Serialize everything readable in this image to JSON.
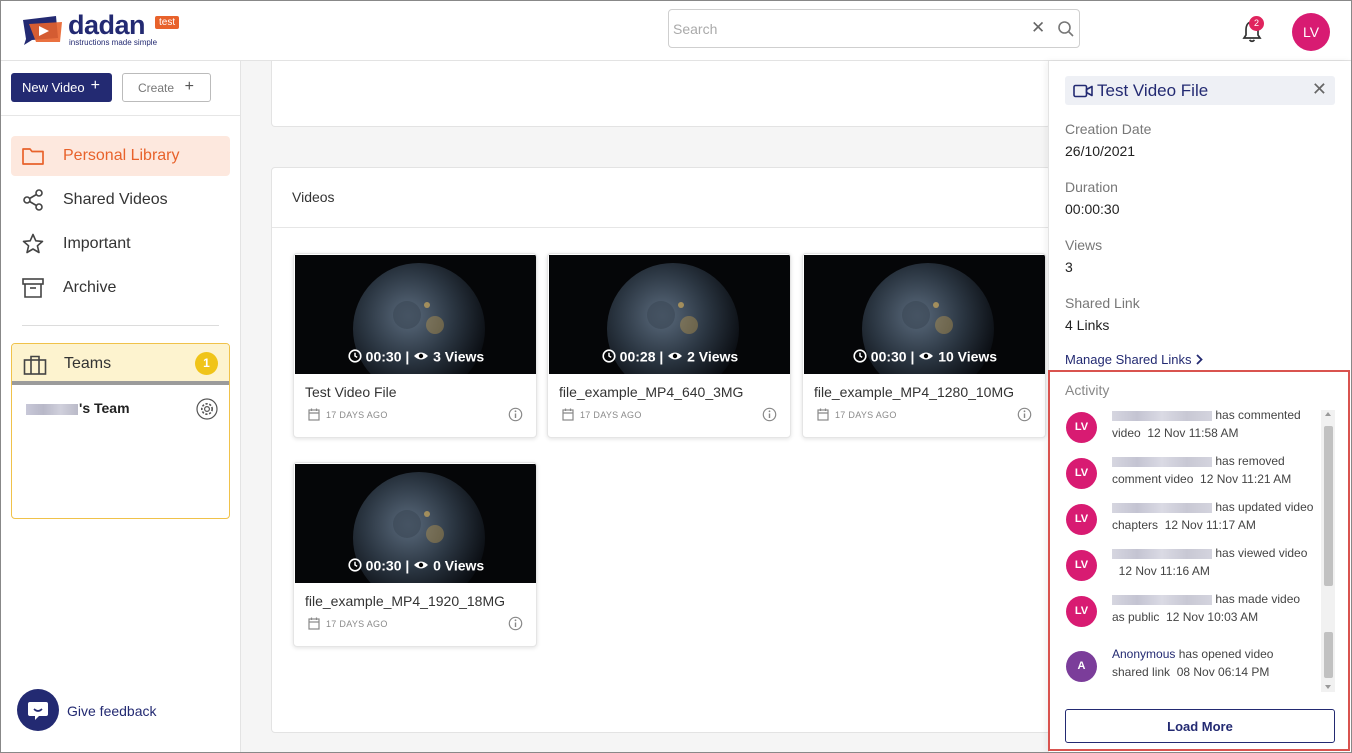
{
  "brand": {
    "name": "dadan",
    "tag": "test",
    "tagline": "instructions made simple"
  },
  "search": {
    "placeholder": "Search",
    "value": ""
  },
  "notifications": {
    "count": "2"
  },
  "user": {
    "initials": "LV"
  },
  "toolbar": {
    "new_video_label": "New Video",
    "create_label": "Create"
  },
  "sidebar": {
    "items": [
      {
        "label": "Personal Library",
        "icon": "folder-icon",
        "active": true
      },
      {
        "label": "Shared Videos",
        "icon": "share-icon"
      },
      {
        "label": "Important",
        "icon": "star-icon"
      },
      {
        "label": "Archive",
        "icon": "archive-icon"
      }
    ],
    "teams": {
      "label": "Teams",
      "count": "1",
      "team_suffix": "'s Team"
    },
    "feedback_label": "Give feedback"
  },
  "main": {
    "section_title": "Videos",
    "videos": [
      {
        "title": "Test Video File",
        "duration": "00:30",
        "views": "3 Views",
        "age": "17 DAYS AGO"
      },
      {
        "title": "file_example_MP4_640_3MG",
        "duration": "00:28",
        "views": "2 Views",
        "age": "17 DAYS AGO"
      },
      {
        "title": "file_example_MP4_1280_10MG",
        "duration": "00:30",
        "views": "10 Views",
        "age": "17 DAYS AGO"
      },
      {
        "title": "file_example_MP4_1920_18MG",
        "duration": "00:30",
        "views": "0 Views",
        "age": "17 DAYS AGO"
      }
    ]
  },
  "detail": {
    "title": "Test Video File",
    "creation_date_label": "Creation Date",
    "creation_date": "26/10/2021",
    "duration_label": "Duration",
    "duration": "00:00:30",
    "views_label": "Views",
    "views": "3",
    "shared_link_label": "Shared Link",
    "shared_link": "4 Links",
    "manage_links_label": "Manage Shared Links",
    "activity_label": "Activity",
    "activity": [
      {
        "avatar": "LV",
        "action": "has commented",
        "rest": "video",
        "time": "12 Nov 11:58 AM"
      },
      {
        "avatar": "LV",
        "action": "has removed",
        "rest": "comment video",
        "time": "12 Nov 11:21 AM"
      },
      {
        "avatar": "LV",
        "action": "has updated video",
        "rest": "chapters",
        "time": "12 Nov 11:17 AM"
      },
      {
        "avatar": "LV",
        "action": "has viewed video",
        "rest": "",
        "time": "12 Nov 11:16 AM"
      },
      {
        "avatar": "LV",
        "action": "has made video",
        "rest": "as public",
        "time": "12 Nov 10:03 AM"
      },
      {
        "avatar": "A",
        "user": "Anonymous",
        "action": "has opened video",
        "rest": "shared link",
        "time": "08 Nov 06:14 PM"
      }
    ],
    "load_more_label": "Load More"
  },
  "colors": {
    "brand_navy": "#232a72",
    "accent_orange": "#e8622b",
    "avatar_pink": "#d81b72",
    "highlight_red": "#d9534f"
  }
}
